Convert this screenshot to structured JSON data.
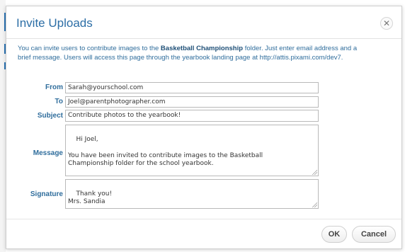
{
  "dialog": {
    "title": "Invite Uploads",
    "close_icon": "close-icon",
    "close_glyph": "✕"
  },
  "intro": {
    "before": "You can invite users to contribute images to the ",
    "folder": "Basketball Championship",
    "after": " folder. Just enter email address and a brief message. Users will access this page through the yearbook landing page at http://attis.pixami.com/dev7."
  },
  "form": {
    "from_label": "From",
    "from_value": "Sarah@yourschool.com",
    "to_label": "To",
    "to_value": "Joel@parentphotographer.com",
    "subject_label": "Subject",
    "subject_value": "Contribute photos to the yearbook!",
    "message_label": "Message",
    "message_value": "Hi Joel,\n\nYou have been invited to contribute images to the Basketball\nChampionship folder for the school yearbook.",
    "signature_label": "Signature",
    "signature_value": "Thank you!\nMrs. Sandia"
  },
  "buttons": {
    "ok": "OK",
    "cancel": "Cancel"
  },
  "colors": {
    "title": "#2c6ea6",
    "labels": "#2f6d9c",
    "accent_strip": "#2a74b5"
  }
}
